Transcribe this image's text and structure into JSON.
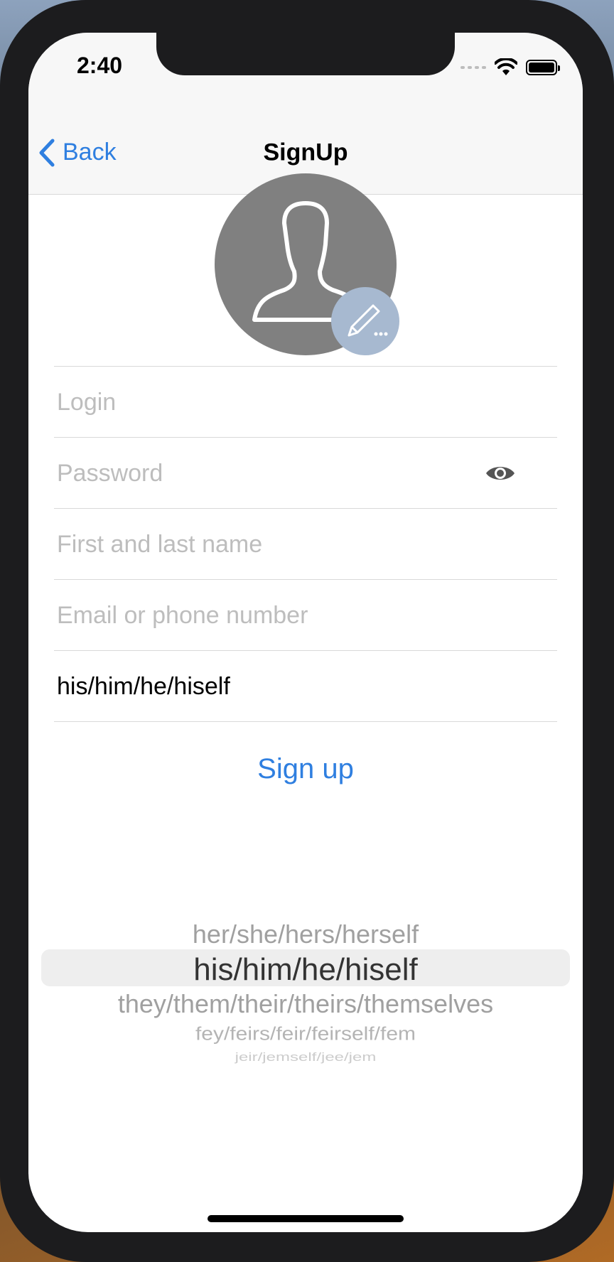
{
  "status_bar": {
    "time": "2:40"
  },
  "nav": {
    "back_label": "Back",
    "title": "SignUp"
  },
  "form": {
    "login_placeholder": "Login",
    "password_placeholder": "Password",
    "name_placeholder": "First and last name",
    "contact_placeholder": "Email or phone number",
    "pronouns_value": "his/him/he/hiself"
  },
  "signup_label": "Sign up",
  "picker": {
    "options": [
      "her/she/hers/herself",
      "his/him/he/hiself",
      "they/them/their/theirs/themselves",
      "fey/feirs/feir/feirself/fem",
      "jeir/jemself/jee/jem"
    ],
    "selected": "his/him/he/hiself"
  },
  "colors": {
    "accent": "#2f7fe0",
    "avatar_bg": "#808080",
    "edit_badge": "#a7b9d0",
    "placeholder": "#bdbdbd"
  },
  "icons": {
    "back": "chevron-left-icon",
    "avatar": "person-silhouette-icon",
    "edit": "pencil-icon",
    "password_toggle": "eye-icon",
    "wifi": "wifi-icon",
    "battery": "battery-icon"
  }
}
